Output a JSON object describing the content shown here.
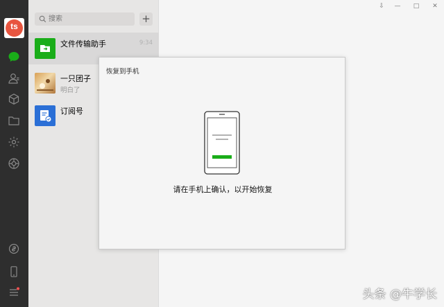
{
  "search": {
    "placeholder": "搜索"
  },
  "add_button": {
    "label": "+"
  },
  "chats": [
    {
      "name": "文件传输助手",
      "preview": "",
      "time": "9:34"
    },
    {
      "name": "一只团子",
      "preview": "明白了",
      "time": ""
    },
    {
      "name": "订阅号",
      "preview": "",
      "time": ""
    }
  ],
  "dialog": {
    "title": "恢复到手机",
    "message": "请在手机上确认，以开始恢复"
  },
  "window_controls": {
    "pin": "⇩",
    "minimize": "—",
    "maximize": "□",
    "close": "✕"
  },
  "watermark": "头条 @牛学长",
  "colors": {
    "accent": "#1aad19",
    "nav_bg": "#2e2e2e",
    "list_bg": "#e7e6e5",
    "main_bg": "#f5f5f5"
  },
  "nav_icons": [
    "chat-icon",
    "contacts-icon",
    "box-icon",
    "folder-icon",
    "mini-program-icon",
    "moments-icon",
    "link-icon",
    "phone-icon",
    "menu-icon"
  ]
}
